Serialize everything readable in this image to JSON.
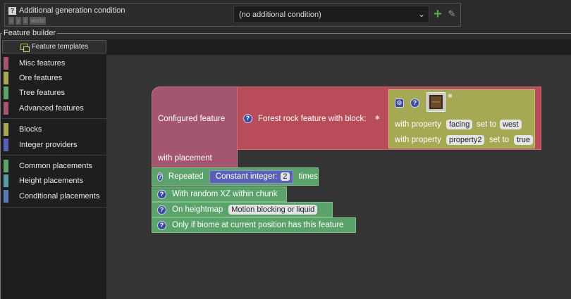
{
  "condition": {
    "title": "Additional generation condition",
    "help": "?",
    "deps": [
      "x",
      "y",
      "z",
      "world"
    ],
    "selected": "(no additional condition)",
    "add_icon": "plus-icon",
    "edit_icon": "pencil-icon"
  },
  "builder": {
    "title": "Feature builder",
    "templates_label": "Feature templates",
    "categories": [
      {
        "label": "Misc features",
        "color": "#a5566f"
      },
      {
        "label": "Ore features",
        "color": "#a6a954"
      },
      {
        "label": "Tree features",
        "color": "#5ba36a"
      },
      {
        "label": "Advanced features",
        "color": "#a5566f"
      },
      {
        "label": "Blocks",
        "color": "#a6a954"
      },
      {
        "label": "Integer providers",
        "color": "#5a60b4"
      },
      {
        "label": "Common placements",
        "color": "#5ba36a"
      },
      {
        "label": "Height placements",
        "color": "#5a9aa5"
      },
      {
        "label": "Conditional placements",
        "color": "#5a7ab4"
      }
    ]
  },
  "blocks": {
    "configured_label": "Configured feature",
    "with_placement": "with placement",
    "forest_label": "Forest rock feature with block:",
    "prop1": {
      "prefix": "with property",
      "name": "facing",
      "mid": "set to",
      "value": "west"
    },
    "prop2": {
      "prefix": "with property",
      "name": "property2",
      "mid": "set to",
      "value": "true"
    },
    "repeated": "Repeated",
    "constant_int": "Constant integer:",
    "constant_val": "2",
    "times": "times",
    "random_xz": "With random XZ within chunk",
    "heightmap": "On heightmap",
    "heightmap_val": "Motion blocking or liquid",
    "biome": "Only if biome at current position has this feature"
  }
}
